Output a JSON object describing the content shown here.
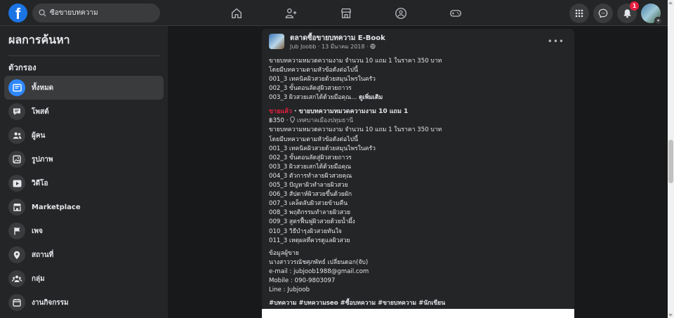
{
  "search": {
    "value": "ซื้อขายบทความ"
  },
  "nav": {
    "notification_count": "1"
  },
  "sidebar": {
    "title": "ผลการค้นหา",
    "section": "ตัวกรอง",
    "items": [
      {
        "label": "ทั้งหมด",
        "icon": "search-results-icon"
      },
      {
        "label": "โพสต์",
        "icon": "post-icon"
      },
      {
        "label": "ผู้คน",
        "icon": "people-icon"
      },
      {
        "label": "รูปภาพ",
        "icon": "photo-icon"
      },
      {
        "label": "วิดีโอ",
        "icon": "video-icon"
      },
      {
        "label": "Marketplace",
        "icon": "marketplace-icon"
      },
      {
        "label": "เพจ",
        "icon": "page-flag-icon"
      },
      {
        "label": "สถานที่",
        "icon": "place-pin-icon"
      },
      {
        "label": "กลุ่ม",
        "icon": "groups-icon"
      },
      {
        "label": "งานกิจกรรม",
        "icon": "events-icon"
      }
    ]
  },
  "post": {
    "page_name": "ตลาดซื้อขายบทความ E-Book",
    "author_date": "Jub Joobb · 13 มีนาคม 2018 · ",
    "intro_lines": [
      "ขายบทความหมวดความงาม จำนวน 10 แถม 1 ในราคา 350 บาท",
      "โดยมีบทความตามหัวข้อดังต่อไปนี้",
      "001_3 เทคนิคผิวสวยด้วยสมุนไพรในครัว",
      "002_3 ขั้นตอนลัดสู่ผิวสวยถาวร"
    ],
    "intro_last": "003_3 ผิวสวยเสกได้ด้วยมือคุณ... ",
    "see_more": "ดูเพิ่มเติม",
    "sold_tag": "ขายแล้ว",
    "listing_title": " · ขายบทความหมวดความงาม 10 แถม 1",
    "price": "฿350 · ",
    "location": "เทศบาลเมืองปทุมธานี",
    "body_lines": [
      "ขายบทความหมวดความงาม จำนวน 10 แถม 1 ในราคา 350 บาท",
      "โดยมีบทความตามหัวข้อดังต่อไปนี้",
      "001_3 เทคนิคผิวสวยด้วยสมุนไพรในครัว",
      "002_3 ขั้นตอนลัดสู่ผิวสวยถาวร",
      "003_3 ผิวสวยเสกได้ด้วยมือคุณ",
      "004_3 ตัวการทำลายผิวสวยคุณ",
      "005_3 ปัญหาผิวทำลายผิวสวย",
      "006_3 สัปดาห์ผิวสวยขึ้นด้วยผัก",
      "007_3 เคล็ดลับผิวสวยข้ามคืน",
      "008_3 พฤติกรรมทำลายผิวสวย",
      "009_3 สูตรฟื้นฟูผิวสวยด้วยน้ำผึ้ง",
      "010_3 วิธีบำรุงผิวสวยทันใจ",
      "011_3 เหตุผลที่ควรดูแลผิวสวย"
    ],
    "seller_lines": [
      "ข้อมูลผู้ขาย",
      "นางสาววรณัชศุภพัทธ์ เปลี่ยนดอก(จับ)",
      "e-mail : jubjoob1988@gmail.com",
      "Mobile : 090-9803097",
      "Line : Jubjoob"
    ],
    "hashtags": "#บทความ #บทความseo #ซื้อบทความ #ขายบทความ #นักเขียน"
  },
  "colors": {
    "accent": "#2d88ff",
    "brand": "#1b74e4",
    "sold": "#e41e3f",
    "badge": "#e41e3f"
  }
}
